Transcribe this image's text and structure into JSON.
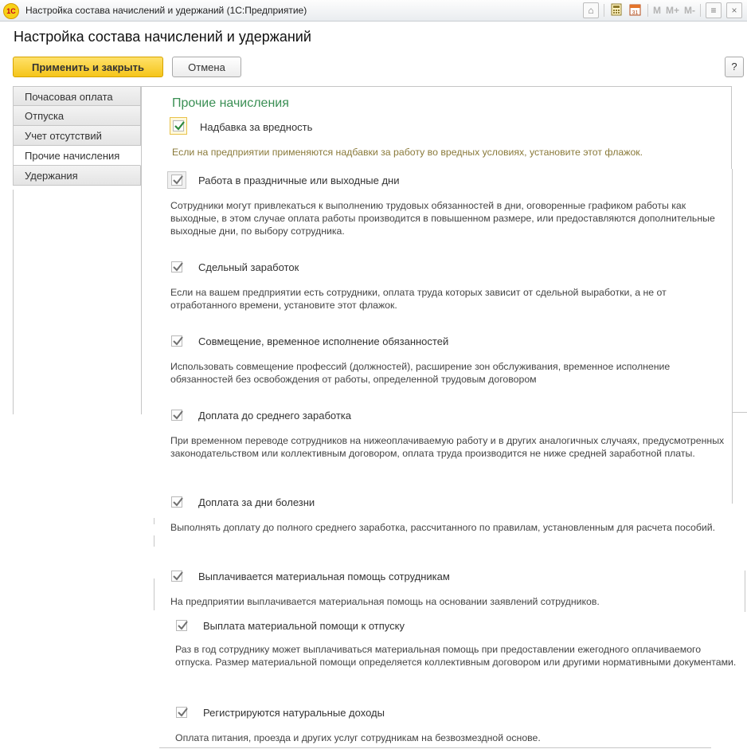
{
  "window": {
    "logo_text": "1С",
    "title": "Настройка состава начислений и удержаний  (1С:Предприятие)",
    "tools": {
      "m": "M",
      "m_plus": "M+",
      "m_minus": "M-"
    }
  },
  "form": {
    "title": "Настройка состава начислений и удержаний",
    "apply_label": "Применить и закрыть",
    "cancel_label": "Отмена",
    "help_label": "?"
  },
  "tabs": [
    {
      "label": "Почасовая оплата"
    },
    {
      "label": "Отпуска"
    },
    {
      "label": "Учет отсутствий"
    },
    {
      "label": "Прочие начисления"
    },
    {
      "label": "Удержания"
    }
  ],
  "section": {
    "title": "Прочие начисления"
  },
  "items": [
    {
      "label": "Надбавка за вредность",
      "checked": true,
      "description": "Если на предприятии применяются надбавки за работу во вредных условиях, установите этот флажок."
    },
    {
      "label": "Работа в праздничные или выходные дни",
      "checked": true,
      "description": "Сотрудники могут привлекаться к выполнению трудовых обязанностей в дни, оговоренные графиком работы как выходные, в этом случае оплата работы производится в повышенном размере, или предоставляются дополнительные выходные дни, по выбору сотрудника."
    },
    {
      "label": "Сдельный заработок",
      "checked": true,
      "description": "Если на вашем предприятии есть сотрудники, оплата труда которых зависит от сдельной выработки, а не от отработанного времени, установите этот флажок."
    },
    {
      "label": "Совмещение, временное исполнение обязанностей",
      "checked": true,
      "description": "Использовать совмещение профессий (должностей), расширение зон обслуживания, временное исполнение обязанностей без освобождения от работы, определенной трудовым договором"
    },
    {
      "label": "Доплата до среднего заработка",
      "checked": true,
      "description": "При временном переводе сотрудников на нижеоплачиваемую работу и в других аналогичных случаях, предусмотренных законодательством или коллективным договором, оплата труда производится не ниже средней заработной платы."
    },
    {
      "label": "Доплата за дни болезни",
      "checked": true,
      "description": "Выполнять доплату до полного среднего заработка, рассчитанного по правилам, установленным для расчета пособий."
    },
    {
      "label": "Выплачивается материальная помощь сотрудникам",
      "checked": true,
      "description": "На предприятии выплачивается материальная помощь на основании заявлений сотрудников."
    },
    {
      "label": "Выплата материальной помощи к отпуску",
      "checked": true,
      "description": "Раз в год сотруднику может выплачиваться материальная помощь при предоставлении ежегодного оплачиваемого отпуска. Размер материальной помощи определяется коллективным договором или другими нормативными документами."
    },
    {
      "label": "Регистрируются натуральные доходы",
      "checked": true,
      "description": "Оплата питания, проезда и других услуг сотрудникам на безвозмездной основе."
    }
  ],
  "colors": {
    "accent_green": "#3a8f54",
    "primary_button": "#f5c51a",
    "hint_text": "#8a7a3a"
  }
}
